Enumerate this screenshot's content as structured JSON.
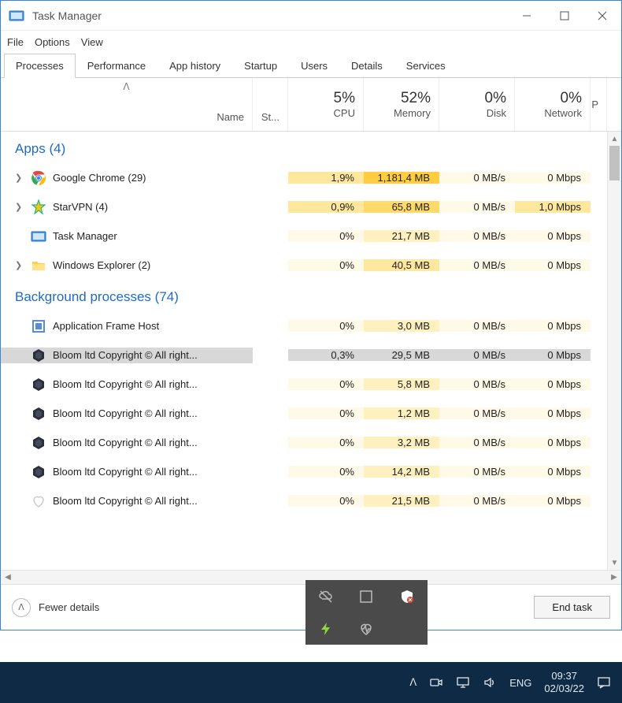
{
  "window": {
    "title": "Task Manager"
  },
  "menu": {
    "file": "File",
    "options": "Options",
    "view": "View"
  },
  "tabs": {
    "processes": "Processes",
    "performance": "Performance",
    "app_history": "App history",
    "startup": "Startup",
    "users": "Users",
    "details": "Details",
    "services": "Services"
  },
  "columns": {
    "name": "Name",
    "status_abbr": "St...",
    "cpu": {
      "pct": "5%",
      "label": "CPU"
    },
    "memory": {
      "pct": "52%",
      "label": "Memory"
    },
    "disk": {
      "pct": "0%",
      "label": "Disk"
    },
    "network": {
      "pct": "0%",
      "label": "Network"
    },
    "extra": "P"
  },
  "groups": {
    "apps": {
      "label": "Apps (4)"
    },
    "bg": {
      "label": "Background processes (74)"
    }
  },
  "rows": {
    "apps": [
      {
        "name": "Google Chrome (29)",
        "icon": "chrome",
        "expandable": true,
        "cpu": "1,9%",
        "cpu_heat": 2,
        "mem": "1,181,4 MB",
        "mem_heat": 4,
        "disk": "0 MB/s",
        "disk_heat": 0,
        "net": "0 Mbps",
        "net_heat": 0
      },
      {
        "name": "StarVPN (4)",
        "icon": "starvpn",
        "expandable": true,
        "cpu": "0,9%",
        "cpu_heat": 2,
        "mem": "65,8 MB",
        "mem_heat": 3,
        "disk": "0 MB/s",
        "disk_heat": 0,
        "net": "1,0 Mbps",
        "net_heat": 2
      },
      {
        "name": "Task Manager",
        "icon": "taskmgr",
        "expandable": false,
        "cpu": "0%",
        "cpu_heat": 0,
        "mem": "21,7 MB",
        "mem_heat": 1,
        "disk": "0 MB/s",
        "disk_heat": 0,
        "net": "0 Mbps",
        "net_heat": 0
      },
      {
        "name": "Windows Explorer (2)",
        "icon": "explorer",
        "expandable": true,
        "cpu": "0%",
        "cpu_heat": 0,
        "mem": "40,5 MB",
        "mem_heat": 2,
        "disk": "0 MB/s",
        "disk_heat": 0,
        "net": "0 Mbps",
        "net_heat": 0
      }
    ],
    "bg": [
      {
        "name": "Application Frame Host",
        "icon": "afh",
        "cpu": "0%",
        "cpu_heat": 0,
        "mem": "3,0 MB",
        "mem_heat": 1,
        "disk": "0 MB/s",
        "disk_heat": 0,
        "net": "0 Mbps",
        "net_heat": 0,
        "selected": false
      },
      {
        "name": "Bloom ltd Copyright © All right...",
        "icon": "bloom",
        "cpu": "0,3%",
        "cpu_heat": 0,
        "mem": "29,5 MB",
        "mem_heat": 0,
        "disk": "0 MB/s",
        "disk_heat": 0,
        "net": "0 Mbps",
        "net_heat": 0,
        "selected": true
      },
      {
        "name": "Bloom ltd Copyright © All right...",
        "icon": "bloom",
        "cpu": "0%",
        "cpu_heat": 0,
        "mem": "5,8 MB",
        "mem_heat": 1,
        "disk": "0 MB/s",
        "disk_heat": 0,
        "net": "0 Mbps",
        "net_heat": 0,
        "selected": false
      },
      {
        "name": "Bloom ltd Copyright © All right...",
        "icon": "bloom",
        "cpu": "0%",
        "cpu_heat": 0,
        "mem": "1,2 MB",
        "mem_heat": 1,
        "disk": "0 MB/s",
        "disk_heat": 0,
        "net": "0 Mbps",
        "net_heat": 0,
        "selected": false
      },
      {
        "name": "Bloom ltd Copyright © All right...",
        "icon": "bloom",
        "cpu": "0%",
        "cpu_heat": 0,
        "mem": "3,2 MB",
        "mem_heat": 1,
        "disk": "0 MB/s",
        "disk_heat": 0,
        "net": "0 Mbps",
        "net_heat": 0,
        "selected": false
      },
      {
        "name": "Bloom ltd Copyright © All right...",
        "icon": "bloom",
        "cpu": "0%",
        "cpu_heat": 0,
        "mem": "14,2 MB",
        "mem_heat": 1,
        "disk": "0 MB/s",
        "disk_heat": 0,
        "net": "0 Mbps",
        "net_heat": 0,
        "selected": false
      },
      {
        "name": "Bloom ltd Copyright © All right...",
        "icon": "heart",
        "cpu": "0%",
        "cpu_heat": 0,
        "mem": "21,5 MB",
        "mem_heat": 1,
        "disk": "0 MB/s",
        "disk_heat": 0,
        "net": "0 Mbps",
        "net_heat": 0,
        "selected": false
      }
    ]
  },
  "footer": {
    "fewer_details": "Fewer details",
    "end_task": "End task"
  },
  "taskbar": {
    "lang": "ENG",
    "time": "09:37",
    "date": "02/03/22"
  }
}
